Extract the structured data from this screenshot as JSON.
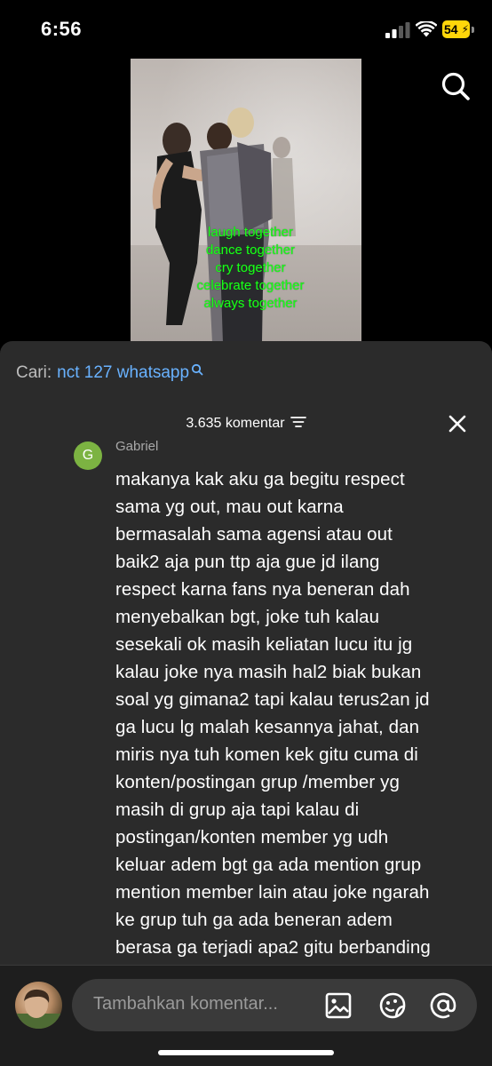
{
  "status_bar": {
    "time": "6:56",
    "battery_level": "54",
    "battery_color": "#ffd60a"
  },
  "video": {
    "caption_lines": [
      "laugh together",
      "dance together",
      "cry together",
      "celebrate together",
      "always together"
    ],
    "caption_color": "#1aff1a"
  },
  "top_actions": {
    "search_icon": "search-icon"
  },
  "comments_sheet": {
    "search_prefix": "Cari:",
    "search_term": "nct 127 whatsapp",
    "comment_count_label": "3.635 komentar",
    "filter_icon": "filter-icon",
    "close_icon": "close-icon",
    "comment": {
      "avatar_letter": "G",
      "avatar_color": "#7cb342",
      "author": "Gabriel",
      "lines": [
        "makanya kak aku ga begitu respect",
        "sama yg out, mau out karna",
        "bermasalah sama agensi atau out",
        "baik2 aja pun ttp aja gue jd ilang",
        "respect karna fans nya beneran dah",
        "menyebalkan bgt, joke tuh kalau",
        "sesekali ok masih keliatan lucu itu jg",
        "kalau joke nya masih hal2 biak bukan",
        "soal yg gimana2 tapi kalau terus2an jd",
        "ga lucu lg malah kesannya jahat, dan",
        "miris nya tuh komen kek gitu cuma di",
        "konten/postingan grup /member yg",
        "masih di grup aja tapi kalau di",
        "postingan/konten member yg udh",
        "keluar adem bgt ga ada mention grup",
        "mention member lain atau joke ngarah",
        "ke grup tuh ga ada beneran adem",
        "berasa ga terjadi apa2 gitu berbanding"
      ]
    }
  },
  "bottom_bar": {
    "input_placeholder": "Tambahkan komentar...",
    "icons": [
      "image-icon",
      "emoji-icon",
      "mention-icon"
    ]
  }
}
